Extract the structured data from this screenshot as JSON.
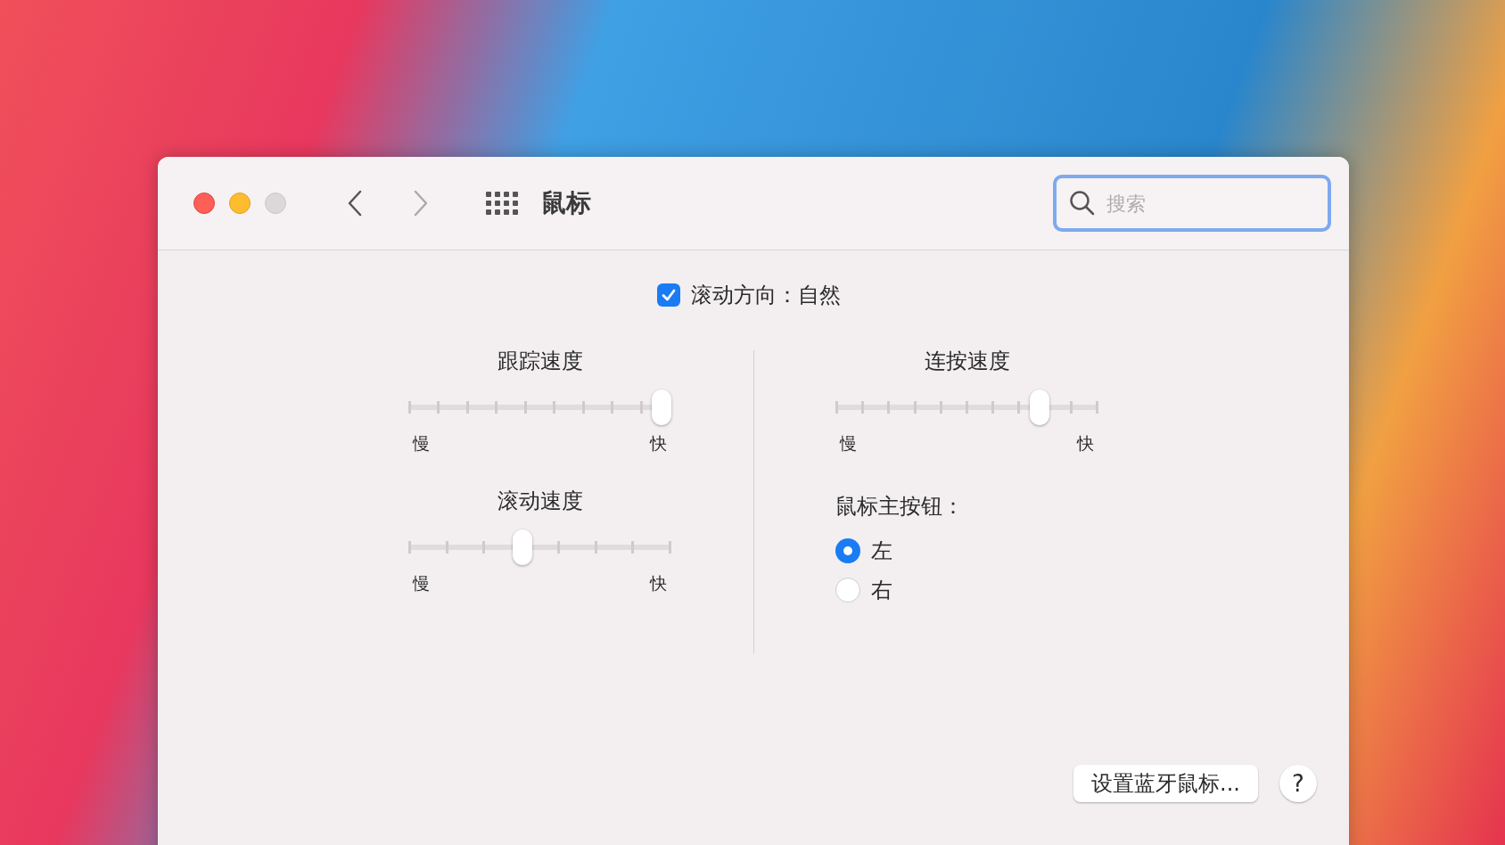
{
  "window": {
    "title": "鼠标",
    "search": {
      "placeholder": "搜索"
    }
  },
  "scroll_direction": {
    "label": "滚动方向：自然",
    "checked": true
  },
  "sliders": [
    {
      "title": "跟踪速度",
      "level": 1,
      "min_label": "慢",
      "max_label": "快"
    },
    {
      "title": "滚动速度",
      "level": 0.43,
      "min_label": "慢",
      "max_label": "快"
    },
    {
      "title": "连按速度",
      "level": 0.8,
      "min_label": "慢",
      "max_label": "快"
    }
  ],
  "primary_button": {
    "label": "鼠标主按钮：",
    "options": [
      {
        "label": "左",
        "selected": true
      },
      {
        "label": "右",
        "selected": false
      }
    ]
  },
  "buttons": {
    "setup": "设置蓝牙鼠标...",
    "help": "?"
  }
}
